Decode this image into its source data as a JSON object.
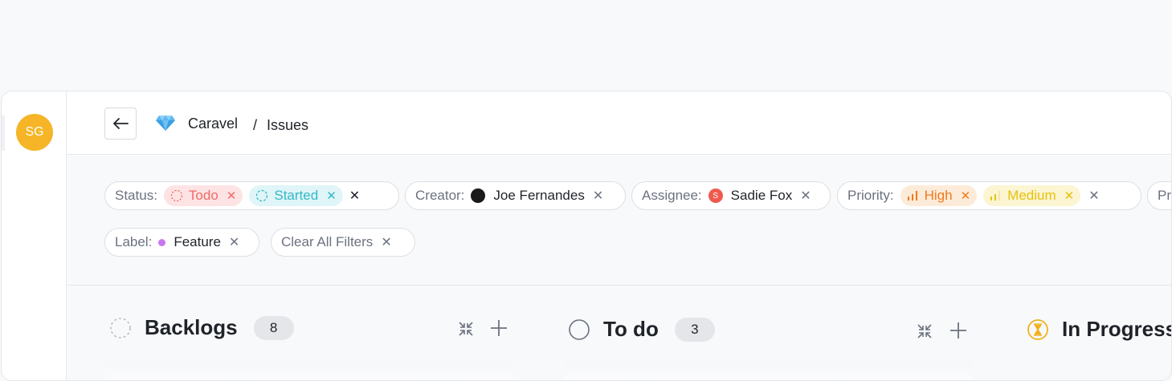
{
  "user": {
    "initials": "SG",
    "avatar_color": "#f5b526"
  },
  "breadcrumb": {
    "project": "Caravel",
    "separator": "/",
    "page": "Issues",
    "project_icon": "gem-icon"
  },
  "filters": {
    "status": {
      "key": "Status:",
      "values": [
        {
          "label": "Todo",
          "color": "#f06a6a",
          "bg": "#fde3e3"
        },
        {
          "label": "Started",
          "color": "#35b8c8",
          "bg": "#dff5f7"
        }
      ]
    },
    "creator": {
      "key": "Creator:",
      "value": "Joe Fernandes"
    },
    "assignee": {
      "key": "Assignee:",
      "value": "Sadie Fox",
      "avatar_letter": "S",
      "avatar_color": "#ef5a4f"
    },
    "priority": {
      "key": "Priority:",
      "values": [
        {
          "label": "High",
          "color": "#f07a1a",
          "bg": "#fdebd9"
        },
        {
          "label": "Medium",
          "color": "#e7c10e",
          "bg": "#fbf5d2"
        }
      ]
    },
    "overflow_label": "Pr",
    "label": {
      "key": "Label:",
      "value": "Feature",
      "dot_color": "#c977f1"
    },
    "clear_all": "Clear All Filters"
  },
  "columns": [
    {
      "title": "Backlogs",
      "count": "8",
      "icon": "dashed-circle-icon"
    },
    {
      "title": "To do",
      "count": "3",
      "icon": "circle-icon"
    },
    {
      "title": "In Progress",
      "icon": "hourglass-icon"
    }
  ]
}
